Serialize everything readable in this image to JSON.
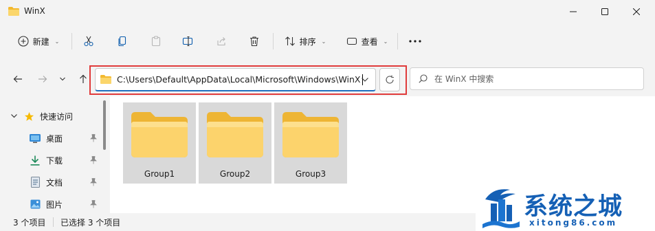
{
  "window": {
    "title": "WinX",
    "minimize_icon": "minimize-icon",
    "maximize_icon": "maximize-icon",
    "close_icon": "close-icon"
  },
  "toolbar": {
    "new_label": "新建",
    "sort_label": "排序",
    "view_label": "查看",
    "icons": [
      "cut-icon",
      "copy-icon",
      "paste-icon",
      "rename-icon",
      "share-icon",
      "delete-icon",
      "more-icon"
    ]
  },
  "address": {
    "path": "C:\\Users\\Default\\AppData\\Local\\Microsoft\\Windows\\WinX",
    "search_placeholder": "在 WinX 中搜索"
  },
  "sidebar": {
    "items": [
      {
        "label": "快速访问",
        "icon": "star-icon"
      },
      {
        "label": "桌面",
        "icon": "desktop-icon"
      },
      {
        "label": "下载",
        "icon": "download-icon"
      },
      {
        "label": "文档",
        "icon": "document-icon"
      },
      {
        "label": "图片",
        "icon": "pictures-icon"
      }
    ]
  },
  "folders": [
    {
      "name": "Group1"
    },
    {
      "name": "Group2"
    },
    {
      "name": "Group3"
    }
  ],
  "status": {
    "item_count": "3 个项目",
    "selected": "已选择 3 个项目"
  },
  "watermark": {
    "title": "系统之城",
    "url": "xitong86.com"
  },
  "colors": {
    "accent": "#1f6fbf",
    "highlight_border": "#e03a3a",
    "folder_yellow": "#f8cf5a",
    "watermark_blue": "#1560b5"
  }
}
